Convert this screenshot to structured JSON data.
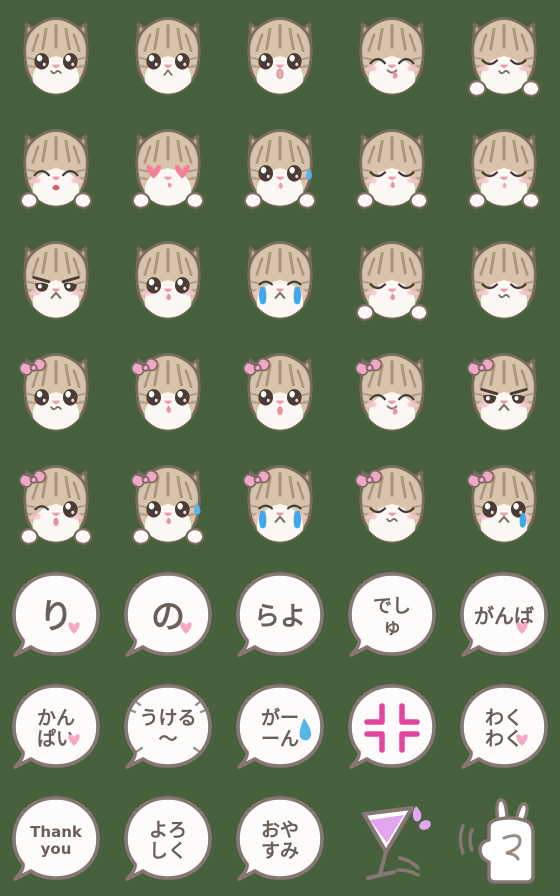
{
  "sheet": {
    "title": "Cat emoji sticker sheet",
    "background_color": "#47613f",
    "columns": 5,
    "rows": 8,
    "cell_size_px": 112
  },
  "palette": {
    "background": "#47613f",
    "fur_light": "#d8c3ab",
    "fur_mid": "#c3ab92",
    "fur_dark": "#9b8570",
    "outline": "#7d6a5f",
    "muzzle": "#fbf7f3",
    "inner_ear": "#f3dedd",
    "nose_pink": "#f09aa8",
    "blush": "#f6c3d2",
    "bow_pink": "#f0a7c8",
    "heart_pink": "#f4809c",
    "bubble_heart": "#f6a9c6",
    "tear_blue": "#3fa9ea",
    "sweat_blue": "#58b4e8",
    "anger_magenta": "#e5449e",
    "cocktail_violet": "#e3a6ee",
    "bubble_fill": "#fdfcfb",
    "bubble_stroke": "#857771",
    "tongue_pink": "#f08fa0"
  },
  "items": [
    {
      "index": 1,
      "row": 1,
      "col": 1,
      "type": "cat",
      "name": "cat-neutral",
      "label": "cat face neutral wavy mouth",
      "bow": false,
      "paws": false,
      "accent": ""
    },
    {
      "index": 2,
      "row": 1,
      "col": 2,
      "type": "cat",
      "name": "cat-sad-frown",
      "label": "cat face sad frown",
      "bow": false,
      "paws": false,
      "accent": ""
    },
    {
      "index": 3,
      "row": 1,
      "col": 3,
      "type": "cat",
      "name": "cat-surprised-open",
      "label": "cat face surprised open mouth",
      "bow": false,
      "paws": false,
      "accent": ""
    },
    {
      "index": 4,
      "row": 1,
      "col": 4,
      "type": "cat",
      "name": "cat-happy-tongue",
      "label": "cat face happy tongue out",
      "bow": false,
      "paws": false,
      "accent": ""
    },
    {
      "index": 5,
      "row": 1,
      "col": 5,
      "type": "cat",
      "name": "cat-shy-paws",
      "label": "cat face shy with paws",
      "bow": false,
      "paws": true,
      "accent": ""
    },
    {
      "index": 6,
      "row": 2,
      "col": 1,
      "type": "cat",
      "name": "cat-laughing-paws",
      "label": "cat face laughing with paws",
      "bow": false,
      "paws": true,
      "accent": ""
    },
    {
      "index": 7,
      "row": 2,
      "col": 2,
      "type": "cat",
      "name": "cat-heart-eyes",
      "label": "cat face heart eyes",
      "bow": false,
      "paws": true,
      "accent": "hearts"
    },
    {
      "index": 8,
      "row": 2,
      "col": 3,
      "type": "cat",
      "name": "cat-worried-sweat",
      "label": "cat face worried sweat drop",
      "bow": false,
      "paws": true,
      "accent": "sweat"
    },
    {
      "index": 9,
      "row": 2,
      "col": 4,
      "type": "cat",
      "name": "cat-content-paws",
      "label": "cat face content with paws",
      "bow": false,
      "paws": true,
      "accent": ""
    },
    {
      "index": 10,
      "row": 2,
      "col": 5,
      "type": "cat",
      "name": "cat-sulking-paws",
      "label": "cat face sulking with paws",
      "bow": false,
      "paws": true,
      "accent": ""
    },
    {
      "index": 11,
      "row": 3,
      "col": 1,
      "type": "cat",
      "name": "cat-angry",
      "label": "cat face angry",
      "bow": false,
      "paws": false,
      "accent": ""
    },
    {
      "index": 12,
      "row": 3,
      "col": 2,
      "type": "cat",
      "name": "cat-pleading",
      "label": "cat face pleading",
      "bow": false,
      "paws": false,
      "accent": ""
    },
    {
      "index": 13,
      "row": 3,
      "col": 3,
      "type": "cat",
      "name": "cat-crying",
      "label": "cat face crying tears",
      "bow": false,
      "paws": false,
      "accent": "tears"
    },
    {
      "index": 14,
      "row": 3,
      "col": 4,
      "type": "cat",
      "name": "cat-sleepy-paws",
      "label": "cat face sleepy with paws",
      "bow": false,
      "paws": true,
      "accent": ""
    },
    {
      "index": 15,
      "row": 3,
      "col": 5,
      "type": "cat",
      "name": "cat-relieved",
      "label": "cat face relieved closed eyes",
      "bow": false,
      "paws": false,
      "accent": ""
    },
    {
      "index": 16,
      "row": 4,
      "col": 1,
      "type": "cat",
      "name": "cat-bow-neutral",
      "label": "cat with bow neutral",
      "bow": true,
      "paws": false,
      "accent": ""
    },
    {
      "index": 17,
      "row": 4,
      "col": 2,
      "type": "cat",
      "name": "cat-bow-tongue",
      "label": "cat with bow tongue out",
      "bow": true,
      "paws": false,
      "accent": ""
    },
    {
      "index": 18,
      "row": 4,
      "col": 3,
      "type": "cat",
      "name": "cat-bow-surprised",
      "label": "cat with bow surprised",
      "bow": true,
      "paws": false,
      "accent": ""
    },
    {
      "index": 19,
      "row": 4,
      "col": 4,
      "type": "cat",
      "name": "cat-bow-wink-tongue",
      "label": "cat with bow wink tongue",
      "bow": true,
      "paws": false,
      "accent": ""
    },
    {
      "index": 20,
      "row": 4,
      "col": 5,
      "type": "cat",
      "name": "cat-bow-angry",
      "label": "cat with bow angry",
      "bow": true,
      "paws": false,
      "accent": ""
    },
    {
      "index": 21,
      "row": 5,
      "col": 1,
      "type": "cat",
      "name": "cat-bow-wink-paws",
      "label": "cat with bow wink paws",
      "bow": true,
      "paws": true,
      "accent": ""
    },
    {
      "index": 22,
      "row": 5,
      "col": 2,
      "type": "cat",
      "name": "cat-bow-sweat-paws",
      "label": "cat with bow sweat paws",
      "bow": true,
      "paws": true,
      "accent": "sweat"
    },
    {
      "index": 23,
      "row": 5,
      "col": 3,
      "type": "cat",
      "name": "cat-bow-crying",
      "label": "cat with bow crying tears",
      "bow": true,
      "paws": false,
      "accent": "tears"
    },
    {
      "index": 24,
      "row": 5,
      "col": 4,
      "type": "cat",
      "name": "cat-bow-sleepy",
      "label": "cat with bow sleepy",
      "bow": true,
      "paws": false,
      "accent": ""
    },
    {
      "index": 25,
      "row": 5,
      "col": 5,
      "type": "cat",
      "name": "cat-bow-teary",
      "label": "cat with bow single tear",
      "bow": true,
      "paws": false,
      "accent": "onetear"
    },
    {
      "index": 26,
      "row": 6,
      "col": 1,
      "type": "bubble",
      "name": "bubble-ri",
      "text": "り",
      "lines": [
        "り"
      ],
      "heart": true,
      "deco": ""
    },
    {
      "index": 27,
      "row": 6,
      "col": 2,
      "type": "bubble",
      "name": "bubble-no",
      "text": "の",
      "lines": [
        "の"
      ],
      "heart": true,
      "deco": ""
    },
    {
      "index": 28,
      "row": 6,
      "col": 3,
      "type": "bubble",
      "name": "bubble-rayo",
      "text": "らよ",
      "lines": [
        "らよ"
      ],
      "heart": false,
      "deco": ""
    },
    {
      "index": 29,
      "row": 6,
      "col": 4,
      "type": "bubble",
      "name": "bubble-deshu",
      "text": "でしゅ",
      "lines": [
        "でし",
        "ゅ"
      ],
      "heart": false,
      "deco": ""
    },
    {
      "index": 30,
      "row": 6,
      "col": 5,
      "type": "bubble",
      "name": "bubble-ganba",
      "text": "がんば",
      "lines": [
        "がんば"
      ],
      "heart": true,
      "deco": ""
    },
    {
      "index": 31,
      "row": 7,
      "col": 1,
      "type": "bubble",
      "name": "bubble-kanpai",
      "text": "かんぱい",
      "lines": [
        "かん",
        "ぱい"
      ],
      "heart": true,
      "deco": ""
    },
    {
      "index": 32,
      "row": 7,
      "col": 2,
      "type": "bubble",
      "name": "bubble-ukeru",
      "text": "うける〜",
      "lines": [
        "うける",
        "〜"
      ],
      "heart": false,
      "deco": "emphasis"
    },
    {
      "index": 33,
      "row": 7,
      "col": 3,
      "type": "bubble",
      "name": "bubble-gaan",
      "text": "がーーん",
      "lines": [
        "がー",
        "ーん"
      ],
      "heart": false,
      "deco": "sweat"
    },
    {
      "index": 34,
      "row": 7,
      "col": 4,
      "type": "bubble",
      "name": "bubble-anger-mark",
      "text": "",
      "lines": [],
      "heart": false,
      "deco": "anger"
    },
    {
      "index": 35,
      "row": 7,
      "col": 5,
      "type": "bubble",
      "name": "bubble-wakuwaku",
      "text": "わくわく",
      "lines": [
        "わく",
        "わく"
      ],
      "heart": true,
      "deco": ""
    },
    {
      "index": 36,
      "row": 8,
      "col": 1,
      "type": "bubble",
      "name": "bubble-thank-you",
      "text": "Thank you",
      "lines": [
        "Thank",
        "you"
      ],
      "heart": false,
      "deco": "latin"
    },
    {
      "index": 37,
      "row": 8,
      "col": 2,
      "type": "bubble",
      "name": "bubble-yoroshiku",
      "text": "よろしく",
      "lines": [
        "よろ",
        "しく"
      ],
      "heart": false,
      "deco": ""
    },
    {
      "index": 38,
      "row": 8,
      "col": 3,
      "type": "bubble",
      "name": "bubble-oyasumi",
      "text": "おやすみ",
      "lines": [
        "おや",
        "すみ"
      ],
      "heart": false,
      "deco": ""
    },
    {
      "index": 39,
      "row": 8,
      "col": 4,
      "type": "icon",
      "name": "cocktail-glass",
      "label": "cocktail glass with splash",
      "text": ""
    },
    {
      "index": 40,
      "row": 8,
      "col": 5,
      "type": "icon",
      "name": "bunny-hand",
      "label": "bunny hand gesture",
      "text": ""
    }
  ]
}
